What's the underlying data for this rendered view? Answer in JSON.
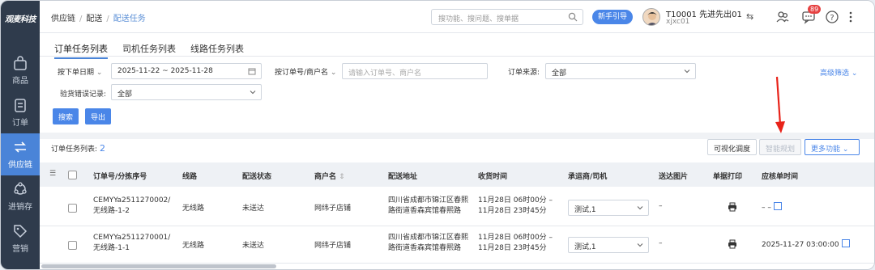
{
  "brand": "观麦科技",
  "sidebar": {
    "items": [
      {
        "label": "商品",
        "icon": "bag-icon"
      },
      {
        "label": "订单",
        "icon": "order-icon"
      },
      {
        "label": "供应链",
        "icon": "supply-chain-icon",
        "active": true
      },
      {
        "label": "进销存",
        "icon": "inventory-icon"
      },
      {
        "label": "营销",
        "icon": "marketing-tag-icon"
      }
    ]
  },
  "breadcrumb": {
    "a": "供应链",
    "b": "配送",
    "c": "配送任务"
  },
  "search": {
    "placeholder": "搜功能、搜问题、搜单据"
  },
  "guide_button": "新手引导",
  "user": {
    "name": "T10001 先进先出01",
    "sub": "xjxc01"
  },
  "notification_count": "89",
  "tabs": [
    "订单任务列表",
    "司机任务列表",
    "线路任务列表"
  ],
  "filters": {
    "date_type": "按下单日期",
    "date_range": "2025-11-22 ~ 2025-11-28",
    "order_no_type": "按订单号/商户名",
    "order_no_placeholder": "请输入订单号、商户名",
    "source_label": "订单来源:",
    "source_value": "全部",
    "check_label": "验货错误记录:",
    "check_value": "全部",
    "advanced": "高级筛选",
    "search_btn": "搜索",
    "export_btn": "导出"
  },
  "table": {
    "title": "订单任务列表:",
    "count": "2",
    "actions": {
      "visual": "可视化调度",
      "smart": "智能规划",
      "more": "更多功能"
    },
    "headers": [
      "订单号/分拣序号",
      "线路",
      "配送状态",
      "商户名",
      "配送地址",
      "收货时间",
      "承运商/司机",
      "送达图片",
      "单据打印",
      "应核单时间"
    ],
    "rows": [
      {
        "order": "CEMYYa2511270002/",
        "sort": "无线路-1-2",
        "route": "无线路",
        "status": "未送达",
        "merchant": "网纬子店铺",
        "addr1": "四川省成都市锦江区春熙",
        "addr2": "路街道香森宾馆春熙路",
        "time1": "11月28日 06时00分 –",
        "time2": "11月28日 23时45分",
        "carrier": "测试,1",
        "photo": "–",
        "check_time": "– –"
      },
      {
        "order": "CEMYYa2511270001/",
        "sort": "无线路-1-1",
        "route": "无线路",
        "status": "未送达",
        "merchant": "网纬子店铺",
        "addr1": "四川省成都市锦江区春熙",
        "addr2": "路街道香森宾馆春熙路",
        "time1": "11月28日 06时00分 –",
        "time2": "11月28日 23时45分",
        "carrier": "测试,1",
        "photo": "–",
        "check_time": "2025-11-27 03:00:00"
      }
    ]
  },
  "colors": {
    "accent": "#4a86e8",
    "sidebar": "#2f3b4c",
    "arrow": "#e8231a"
  }
}
